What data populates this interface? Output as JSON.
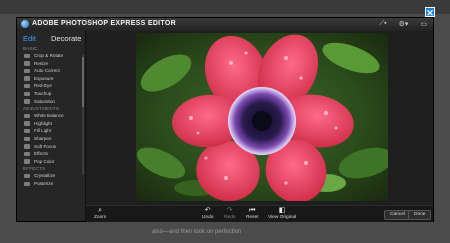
{
  "app": {
    "title": "ADOBE PHOTOSHOP EXPRESS EDITOR"
  },
  "titlebar_icons": [
    "crop-icon",
    "gear-icon",
    "window-icon"
  ],
  "tabs": {
    "edit": "Edit",
    "decorate": "Decorate"
  },
  "sidebar": {
    "basic_head": "BASIC",
    "basic_items": [
      "Crop & Rotate",
      "Resize",
      "Auto Correct",
      "Exposure",
      "Red-Eye",
      "Touchup",
      "Saturation"
    ],
    "adjust_head": "ADJUSTMENTS",
    "adjust_items": [
      "White Balance",
      "Highlight",
      "Fill Light",
      "Sharpen",
      "Soft Focus",
      "Effects",
      "Pop Color",
      "Hue",
      "Black & White",
      "Tint",
      "Sketch",
      "Distort"
    ],
    "effects_head": "EFFECTS",
    "effects_items": [
      "Crystallize",
      "Posterize"
    ]
  },
  "toolbar": {
    "zoom": "Zoom",
    "undo": "Undo",
    "redo": "Redo",
    "reset": "Reset",
    "view_original": "View Original",
    "cancel": "Cancel",
    "done": "Done"
  },
  "background_text": {
    "line1": "...",
    "line2": "also—and then look on perfection"
  }
}
